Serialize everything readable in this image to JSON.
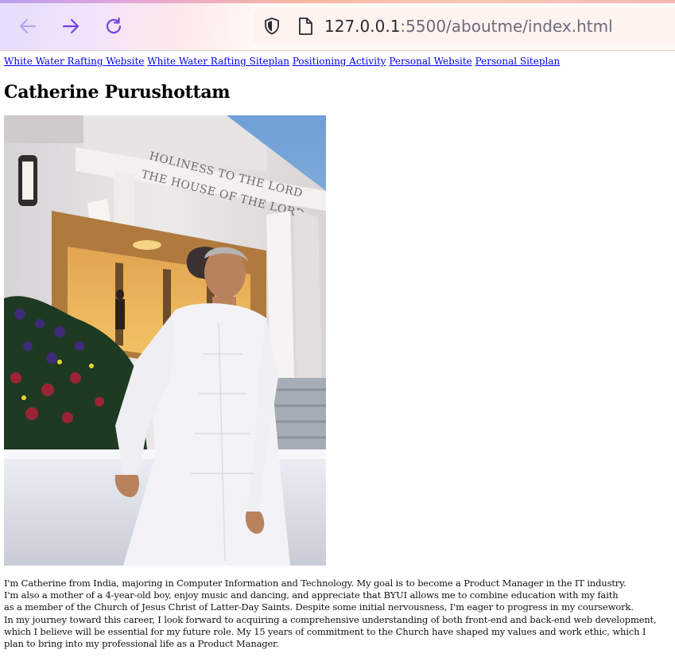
{
  "browser": {
    "url_host": "127.0.0.1",
    "url_rest": ":5500/aboutme/index.html"
  },
  "nav": {
    "links": [
      "White Water Rafting Website",
      "White Water Rafting Siteplan",
      "Positioning Activity",
      "Personal Website",
      "Personal Siteplan"
    ]
  },
  "page": {
    "title": "Catherine Purushottam",
    "photo": {
      "inscription_line1": "HOLINESS TO THE LORD",
      "inscription_line2": "THE HOUSE OF THE LORD"
    },
    "bio_lines": [
      "I'm Catherine from India, majoring in Computer Information and Technology. My goal is to become a Product Manager in the IT industry.",
      "I'm also a mother of a 4-year-old boy, enjoy music and dancing, and appreciate that BYUI allows me to combine education with my faith",
      "as a member of the Church of Jesus Christ of Latter-Day Saints. Despite some initial nervousness, I'm eager to progress in my coursework.",
      "In my journey toward this career, I look forward to acquiring a comprehensive understanding of both front-end and back-end web development,",
      "which I believe will be essential for my future role. My 15 years of commitment to the Church have shaped my values and work ethic, which I",
      "plan to bring into my professional life as a Product Manager."
    ]
  },
  "colors": {
    "link": "#0000ee",
    "chrome_bg": "#fffaf6",
    "nav_icon": "#7542e5"
  }
}
